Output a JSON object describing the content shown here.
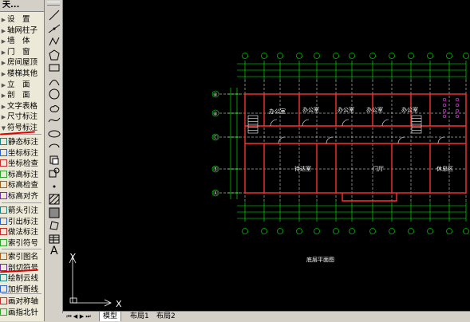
{
  "menu": {
    "title": "天...",
    "items": [
      {
        "label": "设　置",
        "marker": "▶"
      },
      {
        "label": "轴网柱子",
        "marker": "▶"
      },
      {
        "label": "墙　体",
        "marker": "▶"
      },
      {
        "label": "门　窗",
        "marker": "▶"
      },
      {
        "label": "房间屋顶",
        "marker": "▶"
      },
      {
        "label": "楼梯其他",
        "marker": "▶"
      },
      {
        "label": "立　面",
        "marker": "▶"
      },
      {
        "label": "剖　面",
        "marker": "▶"
      },
      {
        "label": "文字表格",
        "marker": "▶"
      },
      {
        "label": "尺寸标注",
        "marker": "▶"
      },
      {
        "label": "符号标注",
        "marker": "▼"
      },
      {
        "label": "静态标注",
        "marker": ""
      },
      {
        "label": "坐标标注",
        "marker": ""
      },
      {
        "label": "坐标检查",
        "marker": ""
      },
      {
        "label": "标高标注",
        "marker": ""
      },
      {
        "label": "标高检查",
        "marker": ""
      },
      {
        "label": "标高对齐",
        "marker": ""
      },
      {
        "label": "箭头引注",
        "marker": ""
      },
      {
        "label": "引出标注",
        "marker": ""
      },
      {
        "label": "做法标注",
        "marker": ""
      },
      {
        "label": "索引符号",
        "marker": ""
      },
      {
        "label": "索引图名",
        "marker": ""
      },
      {
        "label": "剖切符号",
        "marker": ""
      },
      {
        "label": "绘制云线",
        "marker": ""
      },
      {
        "label": "加折断线",
        "marker": ""
      },
      {
        "label": "画对称轴",
        "marker": ""
      },
      {
        "label": "画指北针",
        "marker": ""
      }
    ]
  },
  "drawing": {
    "title": "底层平面图",
    "rooms": [
      "办公室",
      "办公室",
      "办公室",
      "办公室",
      "办公室",
      "待达室",
      "门厅",
      "休息区"
    ],
    "axis_labels_left": [
      "⑥",
      "⑥",
      "Ⓒ",
      "Ⓑ",
      "Ⓐ"
    ],
    "ucs_y": "Y",
    "ucs_x": "X"
  },
  "tabs": [
    "模型",
    "布局1",
    "布局2"
  ],
  "colors": {
    "canvas": "#000000",
    "wall": "#ff3030",
    "dimension": "#00ff00",
    "axis": "#00ff00",
    "text": "#ffffff",
    "highlight": "#e00000"
  }
}
